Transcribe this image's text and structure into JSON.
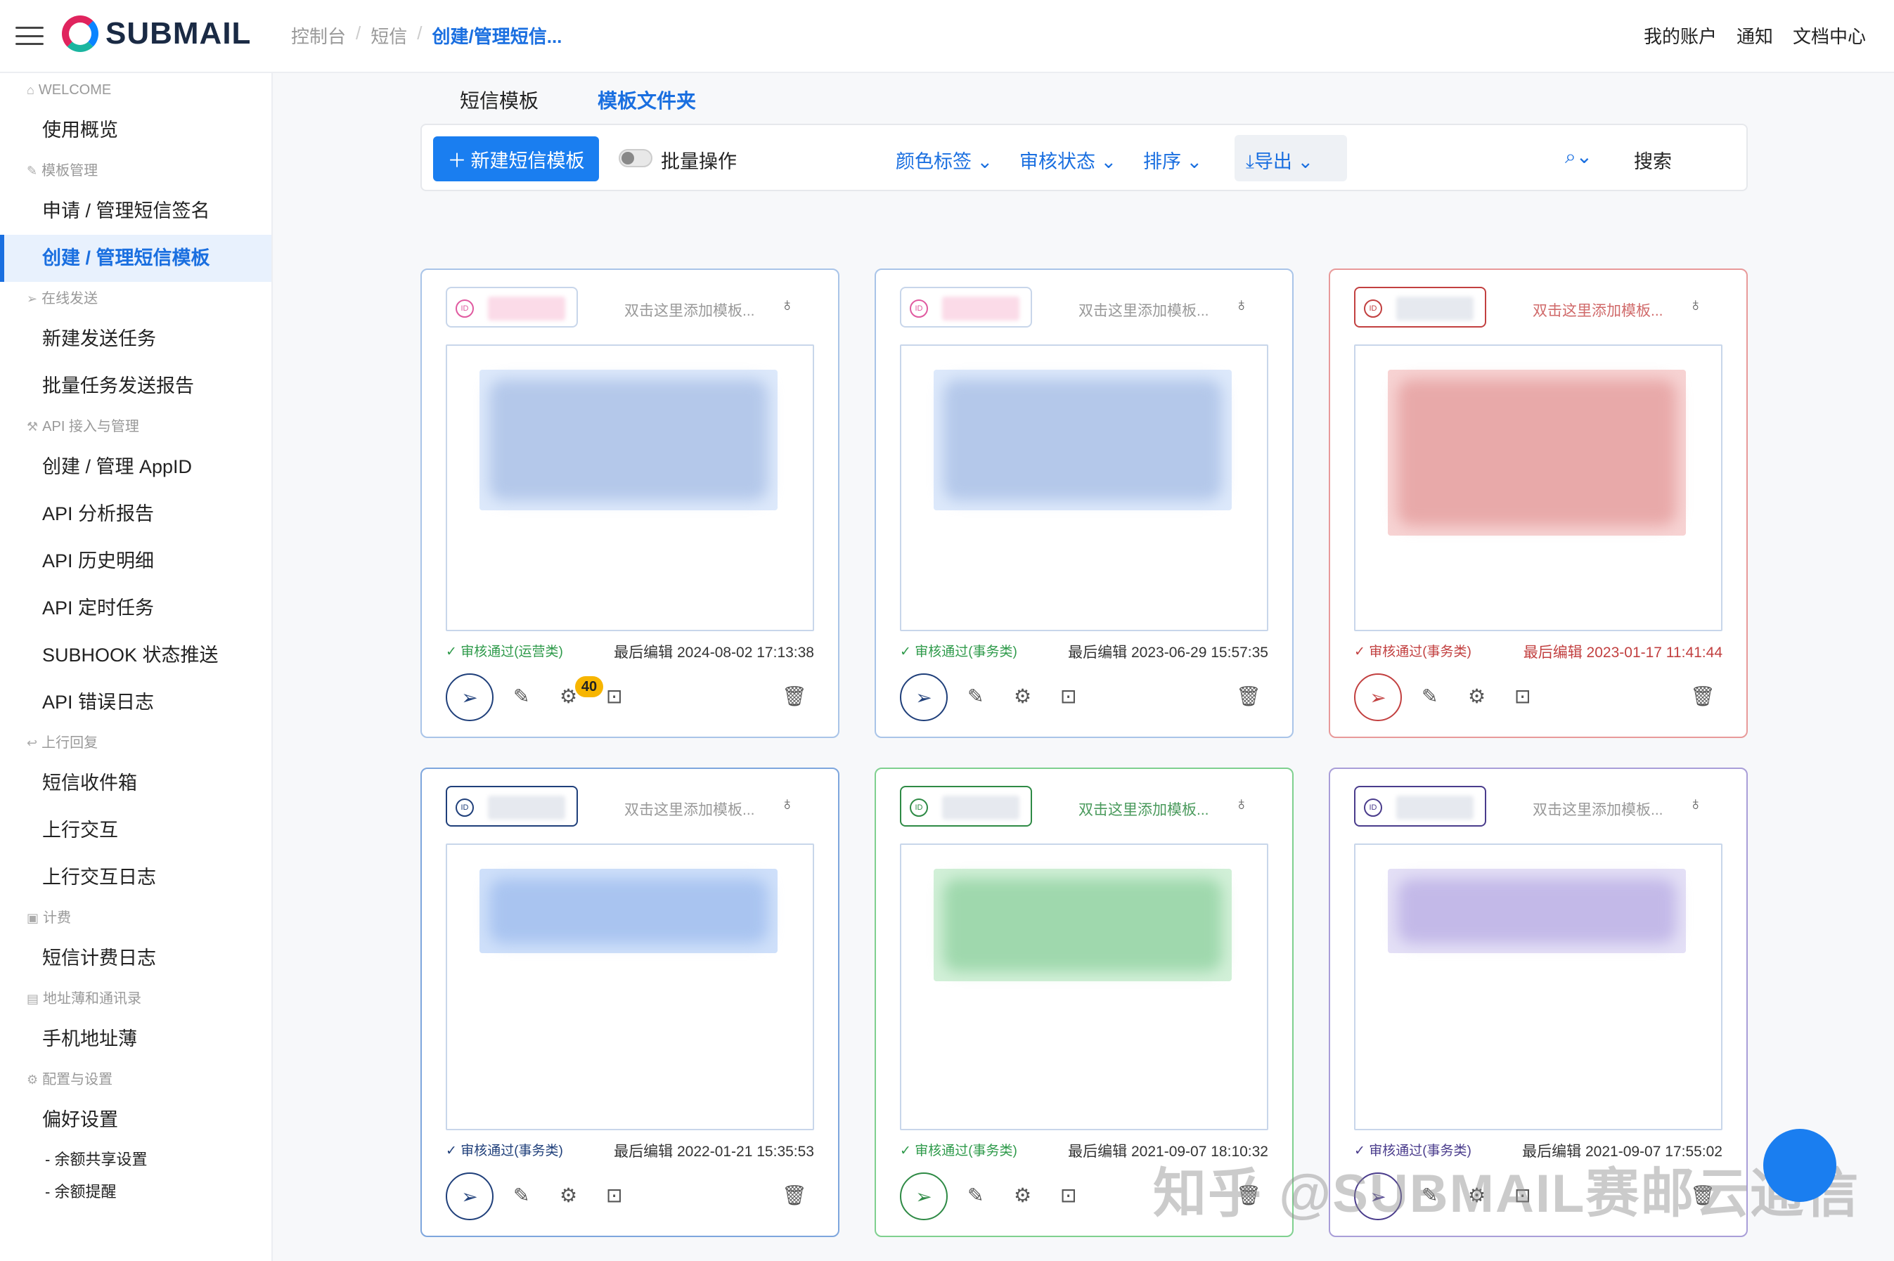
{
  "header": {
    "logo_text": "SUBMAIL",
    "breadcrumb": [
      "控制台",
      "短信",
      "创建/管理短信..."
    ],
    "nav": [
      "我的账户",
      "通知",
      "文档中心"
    ]
  },
  "sidebar": {
    "sections": [
      {
        "title": "WELCOME",
        "items": [
          "使用概览"
        ]
      },
      {
        "title": "模板管理",
        "items": [
          "申请 / 管理短信签名",
          "创建 / 管理短信模板"
        ]
      },
      {
        "title": "在线发送",
        "items": [
          "新建发送任务",
          "批量任务发送报告"
        ]
      },
      {
        "title": "API 接入与管理",
        "items": [
          "创建 / 管理 AppID",
          "API 分析报告",
          "API 历史明细",
          "API 定时任务",
          "SUBHOOK 状态推送",
          "API 错误日志"
        ]
      },
      {
        "title": "上行回复",
        "items": [
          "短信收件箱",
          "上行交互",
          "上行交互日志"
        ]
      },
      {
        "title": "计费",
        "items": [
          "短信计费日志"
        ]
      },
      {
        "title": "地址薄和通讯录",
        "items": [
          "手机地址薄"
        ]
      },
      {
        "title": "配置与设置",
        "items": [
          "偏好设置"
        ]
      }
    ],
    "subitems": [
      "- 余额共享设置",
      "- 余额提醒"
    ],
    "active_item": "创建 / 管理短信模板"
  },
  "tabs": [
    "短信模板",
    "模板文件夹"
  ],
  "toolbar": {
    "new_button": "新建短信模板",
    "batch": "批量操作",
    "filters": [
      "颜色标签",
      "审核状态",
      "排序"
    ],
    "export": "导出",
    "search": "搜索"
  },
  "cards": [
    {
      "color": "#a9c4e8",
      "id_color": "#e05aa0",
      "placeholder": "双击这里添加模板...",
      "status": "审核通过(运营类)",
      "edited": "最后编辑 2024-08-02 17:13:38",
      "badge": "40"
    },
    {
      "color": "#a9c4e8",
      "id_color": "#e05aa0",
      "placeholder": "双击这里添加模板...",
      "status": "审核通过(事务类)",
      "edited": "最后编辑 2023-06-29 15:57:35",
      "badge": ""
    },
    {
      "color": "#e89a9a",
      "id_color": "#c24040",
      "placeholder": "双击这里添加模板...",
      "status": "审核通过(事务类)",
      "edited": "最后编辑 2023-01-17 11:41:44",
      "badge": ""
    },
    {
      "color": "#7ea6dd",
      "id_color": "#1f3f7a",
      "placeholder": "双击这里添加模板...",
      "status": "审核通过(事务类)",
      "edited": "最后编辑 2022-01-21 15:35:53",
      "badge": ""
    },
    {
      "color": "#7fd08f",
      "id_color": "#2e8a45",
      "placeholder": "双击这里添加模板...",
      "status": "审核通过(事务类)",
      "edited": "最后编辑 2021-09-07 18:10:32",
      "badge": ""
    },
    {
      "color": "#a99ed8",
      "id_color": "#4a3c8c",
      "placeholder": "双击这里添加模板...",
      "status": "审核通过(事务类)",
      "edited": "最后编辑 2021-09-07 17:55:02",
      "badge": ""
    }
  ],
  "watermark": "知乎 @SUBMAIL赛邮云通信"
}
